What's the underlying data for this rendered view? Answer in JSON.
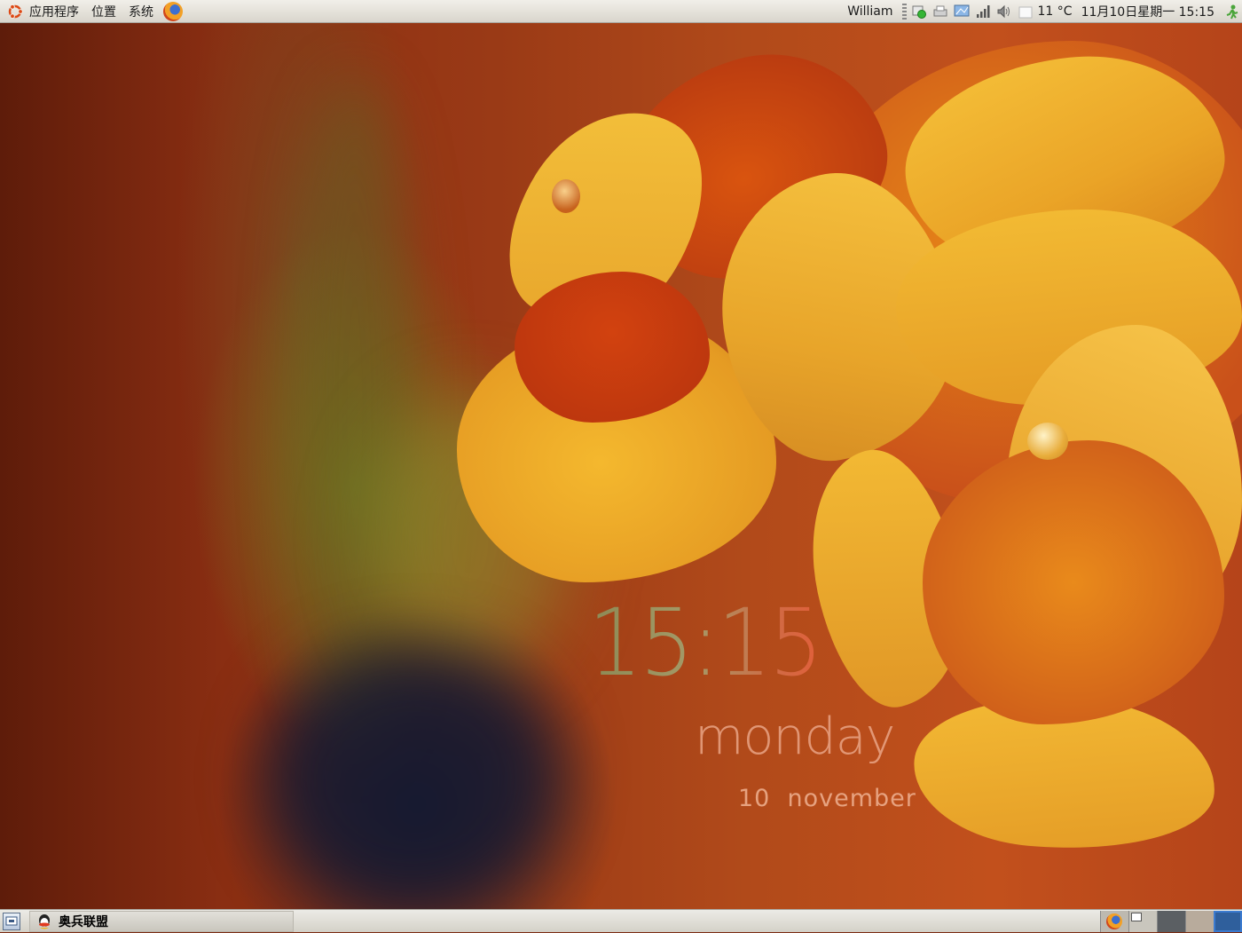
{
  "top_panel": {
    "menus": [
      {
        "label": "应用程序"
      },
      {
        "label": "位置"
      },
      {
        "label": "系统"
      }
    ],
    "user_name": "William",
    "weather": "11 °C",
    "datetime": "11月10日星期一 15:15"
  },
  "clock_widget": {
    "time": "15:15",
    "day": "monday",
    "date": "10  november"
  },
  "taskbar": {
    "window_title": "奥兵联盟"
  },
  "colors": {
    "panel": "#dcd9d2",
    "clock_time_start": "#8c8a55",
    "clock_time_end": "#e25f3a",
    "clock_day": "#e9a485"
  },
  "icons": {
    "menu_logo": "ubuntu-logo-icon",
    "launcher": "firefox-icon",
    "tray": [
      "network-icon",
      "printer-icon",
      "display-icon",
      "signal-icon",
      "volume-icon",
      "weather-icon",
      "logout-icon"
    ],
    "taskbar": "qq-icon",
    "show_desktop": "show-desktop-icon"
  }
}
